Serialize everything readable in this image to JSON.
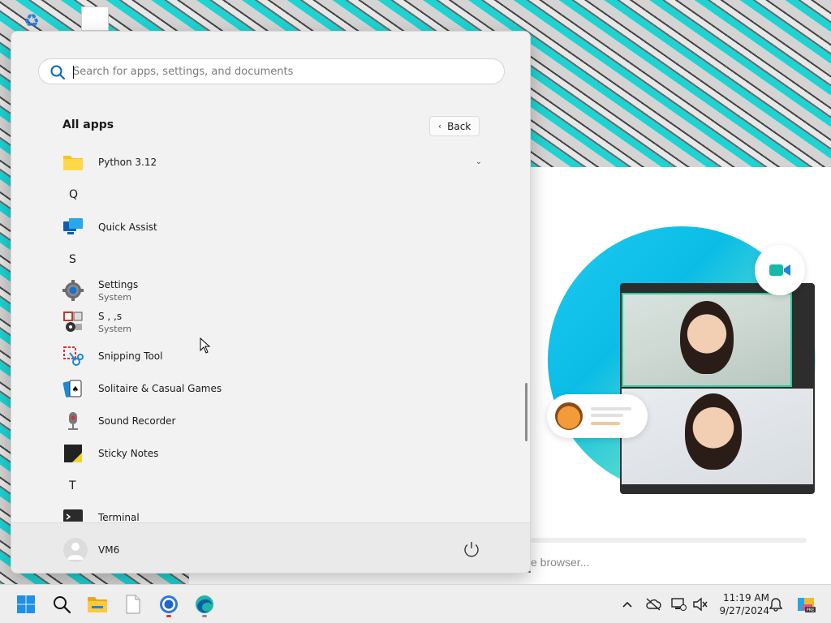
{
  "start_menu": {
    "search": {
      "placeholder": "Search for apps, settings, and documents"
    },
    "all_apps_title": "All apps",
    "back_label": "Back",
    "apps": [
      {
        "type": "app",
        "name": "Python 3.12",
        "icon": "folder-icon",
        "expandable": true
      },
      {
        "type": "letter",
        "label": "Q"
      },
      {
        "type": "app",
        "name": "Quick Assist",
        "icon": "quick-assist-icon"
      },
      {
        "type": "letter",
        "label": "S"
      },
      {
        "type": "app",
        "name": "Settings",
        "subtitle": "System",
        "icon": "gear-icon"
      },
      {
        "type": "app",
        "name": "S   ,  ,s",
        "subtitle": "System",
        "icon": "services-icon"
      },
      {
        "type": "app",
        "name": "Snipping Tool",
        "icon": "snipping-tool-icon"
      },
      {
        "type": "app",
        "name": "Solitaire & Casual Games",
        "icon": "cards-icon"
      },
      {
        "type": "app",
        "name": "Sound Recorder",
        "icon": "microphone-icon"
      },
      {
        "type": "app",
        "name": "Sticky Notes",
        "icon": "sticky-notes-icon"
      },
      {
        "type": "letter",
        "label": "T"
      },
      {
        "type": "app",
        "name": "Terminal",
        "icon": "terminal-icon"
      }
    ],
    "user": {
      "name": "VM6"
    }
  },
  "browser": {
    "bottom_text": "e browser..."
  },
  "taskbar": {
    "clock_time": "11:19 AM",
    "clock_date": "9/27/2024",
    "pinned": [
      "start-icon",
      "search-icon",
      "file-explorer-icon",
      "notepad-icon",
      "chrome-icon",
      "edge-icon"
    ],
    "tray": [
      "chevron-up-icon",
      "cloud-offline-icon",
      "network-icon",
      "speaker-muted-icon",
      "bell-icon",
      "copilot-icon"
    ]
  },
  "colors": {
    "accent": "#0078d4",
    "start_bg": "#f2f2f2",
    "taskbar_bg": "#eeeeee"
  }
}
